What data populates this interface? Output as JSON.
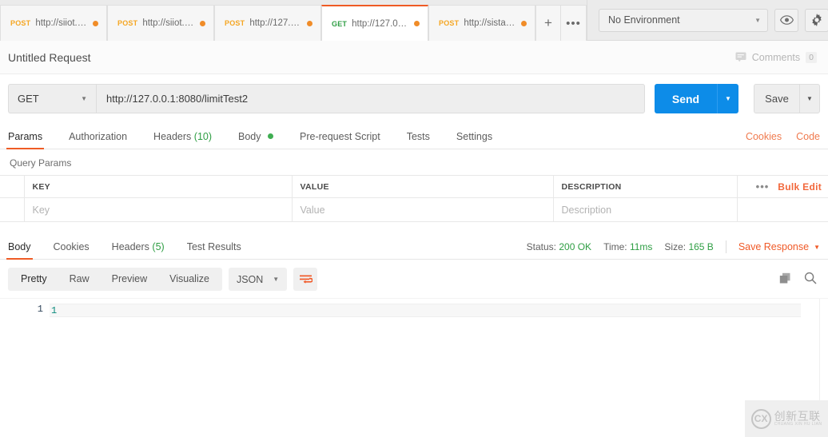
{
  "tabbar": {
    "tabs": [
      {
        "method": "POST",
        "name": "http://siiot.e…",
        "unsaved": true,
        "active": false
      },
      {
        "method": "POST",
        "name": "http://siiot.e…",
        "unsaved": true,
        "active": false
      },
      {
        "method": "POST",
        "name": "http://127.0.…",
        "unsaved": true,
        "active": false
      },
      {
        "method": "GET",
        "name": "http://127.0.0.…",
        "unsaved": true,
        "active": true
      },
      {
        "method": "POST",
        "name": "http://sistar…",
        "unsaved": true,
        "active": false
      }
    ],
    "new_tab_label": "+",
    "more_label": "•••",
    "environment": {
      "selected": "No Environment",
      "caret": "▼"
    },
    "eye_icon": "eye-icon",
    "settings_icon": "gear-icon"
  },
  "request_header": {
    "title": "Untitled Request",
    "comments_label": "Comments",
    "comments_count": "0",
    "comments_icon": "comment-bubble-icon"
  },
  "url_bar": {
    "method": "GET",
    "method_caret": "▼",
    "url": "http://127.0.0.1:8080/limitTest2",
    "send_label": "Send",
    "send_caret": "▼",
    "save_label": "Save",
    "save_caret": "▼",
    "send_color": "#0d8ce8"
  },
  "request_tabs": {
    "items": [
      {
        "label": "Params",
        "active": true
      },
      {
        "label": "Authorization",
        "active": false
      },
      {
        "label": "Headers",
        "count": "(10)",
        "active": false
      },
      {
        "label": "Body",
        "dot": true,
        "active": false
      },
      {
        "label": "Pre-request Script",
        "active": false
      },
      {
        "label": "Tests",
        "active": false
      },
      {
        "label": "Settings",
        "active": false
      }
    ],
    "cookies_link": "Cookies",
    "code_link": "Code",
    "accent_color": "#ef5b25"
  },
  "query_params": {
    "section_label": "Query Params",
    "columns": [
      "KEY",
      "VALUE",
      "DESCRIPTION"
    ],
    "placeholder_row": [
      "Key",
      "Value",
      "Description"
    ],
    "dots_label": "•••",
    "bulk_edit_label": "Bulk Edit"
  },
  "response": {
    "tabs": [
      {
        "label": "Body",
        "active": true
      },
      {
        "label": "Cookies",
        "active": false
      },
      {
        "label": "Headers",
        "count": "(5)",
        "active": false
      },
      {
        "label": "Test Results",
        "active": false
      }
    ],
    "status_label": "Status:",
    "status_value": "200 OK",
    "time_label": "Time:",
    "time_value": "11ms",
    "size_label": "Size:",
    "size_value": "165 B",
    "save_response_label": "Save Response",
    "save_response_caret": "▼",
    "status_color": "#2f9e44"
  },
  "body_toolbar": {
    "views": [
      {
        "label": "Pretty",
        "active": true
      },
      {
        "label": "Raw",
        "active": false
      },
      {
        "label": "Preview",
        "active": false
      },
      {
        "label": "Visualize",
        "active": false
      }
    ],
    "format": "JSON",
    "format_caret": "▼",
    "wrap_icon": "wrap-lines-icon",
    "copy_icon": "copy-icon",
    "search_icon": "search-icon"
  },
  "editor": {
    "lines": [
      {
        "number": "1",
        "content": "1"
      }
    ]
  },
  "watermark": {
    "mark": "CX",
    "cn_text": "创新互联",
    "pinyin": "CHUANG XIN HU LIAN"
  }
}
